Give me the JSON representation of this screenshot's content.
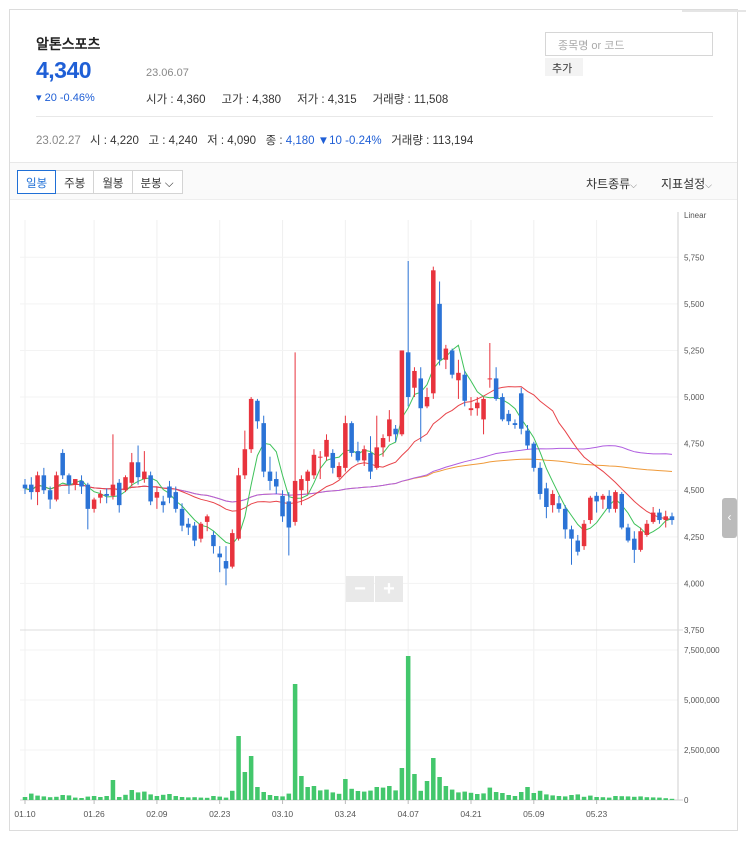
{
  "stock": {
    "name": "알톤스포츠",
    "price": "4,340",
    "date": "23.06.07",
    "change": "▾ 20 -0.46%",
    "stats": [
      "시가 : 4,360",
      "고가 : 4,380",
      "저가 : 4,315",
      "거래량 : 11,508"
    ]
  },
  "search": {
    "placeholder": "종목명 or 코드",
    "add_label": "추가"
  },
  "history": {
    "date": "23.02.27",
    "open": "시 : 4,220",
    "high": "고 : 4,240",
    "low": "저 : 4,090",
    "close_label": "종 :",
    "close_value": "4,180",
    "change": "▼10 -0.24%",
    "volume": "거래량 : 113,194"
  },
  "toolbar": {
    "tabs": [
      "일봉",
      "주봉",
      "월봉",
      "분봉"
    ],
    "chart_type": "차트종류",
    "indicator": "지표설정"
  },
  "colors": {
    "up": "#e8333d",
    "down": "#2b73d6",
    "ma5": "#3ec25a",
    "ma20": "#e8444a",
    "ma60": "#b05ee0",
    "ma120": "#ef9a3a",
    "volume": "#43c76c"
  },
  "chart_data": {
    "type": "candlestick",
    "price_axis": {
      "scale_label": "Linear",
      "ticks": [
        "5,750",
        "5,500",
        "5,250",
        "5,000",
        "4,750",
        "4,500",
        "4,250",
        "4,000",
        "3,750"
      ],
      "range": [
        3750,
        5950
      ]
    },
    "volume_axis": {
      "ticks": [
        "7,500,000",
        "5,000,000",
        "2,500,000",
        "0"
      ],
      "range": [
        0,
        8400000
      ]
    },
    "x_ticks": [
      {
        "label": "01.10",
        "index": 0
      },
      {
        "label": "01.26",
        "index": 11
      },
      {
        "label": "02.09",
        "index": 21
      },
      {
        "label": "02.23",
        "index": 31
      },
      {
        "label": "03.10",
        "index": 41
      },
      {
        "label": "03.24",
        "index": 51
      },
      {
        "label": "04.07",
        "index": 61
      },
      {
        "label": "04.21",
        "index": 71
      },
      {
        "label": "05.09",
        "index": 81
      },
      {
        "label": "05.23",
        "index": 91
      }
    ],
    "candles": [
      {
        "o": 4530,
        "h": 4560,
        "l": 4480,
        "c": 4510
      },
      {
        "o": 4530,
        "h": 4570,
        "l": 4450,
        "c": 4490
      },
      {
        "o": 4490,
        "h": 4600,
        "l": 4420,
        "c": 4580
      },
      {
        "o": 4580,
        "h": 4620,
        "l": 4480,
        "c": 4500
      },
      {
        "o": 4500,
        "h": 4520,
        "l": 4400,
        "c": 4450
      },
      {
        "o": 4450,
        "h": 4600,
        "l": 4440,
        "c": 4580
      },
      {
        "o": 4700,
        "h": 4720,
        "l": 4560,
        "c": 4580
      },
      {
        "o": 4580,
        "h": 4590,
        "l": 4480,
        "c": 4530
      },
      {
        "o": 4530,
        "h": 4560,
        "l": 4500,
        "c": 4560
      },
      {
        "o": 4550,
        "h": 4580,
        "l": 4480,
        "c": 4520
      },
      {
        "o": 4530,
        "h": 4540,
        "l": 4290,
        "c": 4400
      },
      {
        "o": 4400,
        "h": 4460,
        "l": 4380,
        "c": 4450
      },
      {
        "o": 4460,
        "h": 4500,
        "l": 4430,
        "c": 4480
      },
      {
        "o": 4480,
        "h": 4510,
        "l": 4430,
        "c": 4470
      },
      {
        "o": 4470,
        "h": 4800,
        "l": 4450,
        "c": 4530
      },
      {
        "o": 4540,
        "h": 4560,
        "l": 4380,
        "c": 4420
      },
      {
        "o": 4500,
        "h": 4580,
        "l": 4490,
        "c": 4570
      },
      {
        "o": 4540,
        "h": 4700,
        "l": 4520,
        "c": 4650
      },
      {
        "o": 4650,
        "h": 4740,
        "l": 4530,
        "c": 4570
      },
      {
        "o": 4560,
        "h": 4710,
        "l": 4540,
        "c": 4600
      },
      {
        "o": 4580,
        "h": 4600,
        "l": 4420,
        "c": 4440
      },
      {
        "o": 4460,
        "h": 4520,
        "l": 4400,
        "c": 4490
      },
      {
        "o": 4440,
        "h": 4470,
        "l": 4380,
        "c": 4420
      },
      {
        "o": 4520,
        "h": 4550,
        "l": 4430,
        "c": 4460
      },
      {
        "o": 4490,
        "h": 4520,
        "l": 4380,
        "c": 4400
      },
      {
        "o": 4400,
        "h": 4430,
        "l": 4280,
        "c": 4310
      },
      {
        "o": 4320,
        "h": 4350,
        "l": 4260,
        "c": 4300
      },
      {
        "o": 4310,
        "h": 4330,
        "l": 4200,
        "c": 4230
      },
      {
        "o": 4240,
        "h": 4330,
        "l": 4220,
        "c": 4320
      },
      {
        "o": 4330,
        "h": 4370,
        "l": 4280,
        "c": 4360
      },
      {
        "o": 4260,
        "h": 4280,
        "l": 4160,
        "c": 4200
      },
      {
        "o": 4160,
        "h": 4200,
        "l": 4060,
        "c": 4140
      },
      {
        "o": 4120,
        "h": 4200,
        "l": 3990,
        "c": 4080
      },
      {
        "o": 4090,
        "h": 4290,
        "l": 4080,
        "c": 4270
      },
      {
        "o": 4240,
        "h": 4620,
        "l": 4230,
        "c": 4580
      },
      {
        "o": 4580,
        "h": 4820,
        "l": 4560,
        "c": 4720
      },
      {
        "o": 4720,
        "h": 5000,
        "l": 4700,
        "c": 4990
      },
      {
        "o": 4980,
        "h": 4990,
        "l": 4830,
        "c": 4870
      },
      {
        "o": 4860,
        "h": 4900,
        "l": 4570,
        "c": 4600
      },
      {
        "o": 4600,
        "h": 4680,
        "l": 4500,
        "c": 4550
      },
      {
        "o": 4560,
        "h": 4600,
        "l": 4480,
        "c": 4520
      },
      {
        "o": 4470,
        "h": 4500,
        "l": 4330,
        "c": 4360
      },
      {
        "o": 4440,
        "h": 4490,
        "l": 4150,
        "c": 4300
      },
      {
        "o": 4330,
        "h": 5240,
        "l": 4310,
        "c": 4550
      },
      {
        "o": 4500,
        "h": 4580,
        "l": 4420,
        "c": 4560
      },
      {
        "o": 4550,
        "h": 4610,
        "l": 4480,
        "c": 4600
      },
      {
        "o": 4580,
        "h": 4720,
        "l": 4560,
        "c": 4690
      },
      {
        "o": 4680,
        "h": 4710,
        "l": 4560,
        "c": 4680
      },
      {
        "o": 4680,
        "h": 4800,
        "l": 4660,
        "c": 4770
      },
      {
        "o": 4700,
        "h": 4720,
        "l": 4590,
        "c": 4620
      },
      {
        "o": 4570,
        "h": 4650,
        "l": 4560,
        "c": 4630
      },
      {
        "o": 4620,
        "h": 4900,
        "l": 4600,
        "c": 4860
      },
      {
        "o": 4860,
        "h": 4870,
        "l": 4680,
        "c": 4700
      },
      {
        "o": 4710,
        "h": 4760,
        "l": 4650,
        "c": 4660
      },
      {
        "o": 4660,
        "h": 4740,
        "l": 4630,
        "c": 4720
      },
      {
        "o": 4700,
        "h": 4790,
        "l": 4560,
        "c": 4600
      },
      {
        "o": 4620,
        "h": 4900,
        "l": 4610,
        "c": 4730
      },
      {
        "o": 4730,
        "h": 4800,
        "l": 4680,
        "c": 4780
      },
      {
        "o": 4790,
        "h": 4930,
        "l": 4760,
        "c": 4880
      },
      {
        "o": 4830,
        "h": 4850,
        "l": 4760,
        "c": 4800
      },
      {
        "o": 4800,
        "h": 5250,
        "l": 4790,
        "c": 5250
      },
      {
        "o": 5240,
        "h": 5730,
        "l": 4950,
        "c": 5000
      },
      {
        "o": 5050,
        "h": 5160,
        "l": 5000,
        "c": 5140
      },
      {
        "o": 5100,
        "h": 5160,
        "l": 4760,
        "c": 4940
      },
      {
        "o": 4950,
        "h": 5050,
        "l": 4940,
        "c": 5000
      },
      {
        "o": 5020,
        "h": 5700,
        "l": 4990,
        "c": 5680
      },
      {
        "o": 5500,
        "h": 5620,
        "l": 5170,
        "c": 5200
      },
      {
        "o": 5200,
        "h": 5280,
        "l": 5150,
        "c": 5260
      },
      {
        "o": 5250,
        "h": 5260,
        "l": 5100,
        "c": 5120
      },
      {
        "o": 5090,
        "h": 5200,
        "l": 4990,
        "c": 5130
      },
      {
        "o": 5120,
        "h": 5140,
        "l": 4950,
        "c": 4980
      },
      {
        "o": 4930,
        "h": 5000,
        "l": 4900,
        "c": 4940
      },
      {
        "o": 4940,
        "h": 5000,
        "l": 4900,
        "c": 4970
      },
      {
        "o": 4880,
        "h": 5000,
        "l": 4800,
        "c": 4990
      },
      {
        "o": 5100,
        "h": 5290,
        "l": 5050,
        "c": 5100
      },
      {
        "o": 5100,
        "h": 5160,
        "l": 4980,
        "c": 4990
      },
      {
        "o": 5000,
        "h": 5020,
        "l": 4870,
        "c": 4880
      },
      {
        "o": 4910,
        "h": 4930,
        "l": 4850,
        "c": 4870
      },
      {
        "o": 4860,
        "h": 4880,
        "l": 4830,
        "c": 4850
      },
      {
        "o": 5020,
        "h": 5050,
        "l": 4800,
        "c": 4830
      },
      {
        "o": 4820,
        "h": 4850,
        "l": 4720,
        "c": 4740
      },
      {
        "o": 4750,
        "h": 4760,
        "l": 4600,
        "c": 4620
      },
      {
        "o": 4620,
        "h": 4650,
        "l": 4450,
        "c": 4480
      },
      {
        "o": 4510,
        "h": 4540,
        "l": 4350,
        "c": 4410
      },
      {
        "o": 4420,
        "h": 4500,
        "l": 4380,
        "c": 4480
      },
      {
        "o": 4430,
        "h": 4470,
        "l": 4380,
        "c": 4400
      },
      {
        "o": 4400,
        "h": 4420,
        "l": 4240,
        "c": 4290
      },
      {
        "o": 4290,
        "h": 4310,
        "l": 4100,
        "c": 4240
      },
      {
        "o": 4230,
        "h": 4260,
        "l": 4150,
        "c": 4170
      },
      {
        "o": 4200,
        "h": 4340,
        "l": 4180,
        "c": 4320
      },
      {
        "o": 4340,
        "h": 4470,
        "l": 4320,
        "c": 4460
      },
      {
        "o": 4470,
        "h": 4490,
        "l": 4380,
        "c": 4440
      },
      {
        "o": 4450,
        "h": 4480,
        "l": 4400,
        "c": 4470
      },
      {
        "o": 4470,
        "h": 4500,
        "l": 4380,
        "c": 4400
      },
      {
        "o": 4400,
        "h": 4500,
        "l": 4380,
        "c": 4490
      },
      {
        "o": 4480,
        "h": 4490,
        "l": 4290,
        "c": 4300
      },
      {
        "o": 4300,
        "h": 4320,
        "l": 4220,
        "c": 4230
      },
      {
        "o": 4240,
        "h": 4280,
        "l": 4110,
        "c": 4180
      },
      {
        "o": 4180,
        "h": 4300,
        "l": 4170,
        "c": 4280
      },
      {
        "o": 4260,
        "h": 4340,
        "l": 4250,
        "c": 4320
      },
      {
        "o": 4330,
        "h": 4410,
        "l": 4320,
        "c": 4380
      },
      {
        "o": 4380,
        "h": 4400,
        "l": 4320,
        "c": 4340
      },
      {
        "o": 4340,
        "h": 4390,
        "l": 4300,
        "c": 4360
      },
      {
        "o": 4360,
        "h": 4380,
        "l": 4315,
        "c": 4340
      }
    ],
    "volume": [
      150000,
      320000,
      220000,
      180000,
      140000,
      160000,
      250000,
      230000,
      120000,
      100000,
      170000,
      200000,
      150000,
      200000,
      1000000,
      150000,
      260000,
      500000,
      380000,
      420000,
      280000,
      200000,
      260000,
      300000,
      200000,
      150000,
      130000,
      140000,
      120000,
      110000,
      200000,
      170000,
      120000,
      460000,
      3200000,
      1400000,
      2200000,
      650000,
      400000,
      250000,
      200000,
      180000,
      320000,
      5800000,
      1200000,
      650000,
      700000,
      480000,
      520000,
      380000,
      310000,
      1050000,
      560000,
      450000,
      420000,
      470000,
      650000,
      620000,
      700000,
      480000,
      1600000,
      7200000,
      1300000,
      460000,
      950000,
      2100000,
      1150000,
      700000,
      520000,
      380000,
      420000,
      360000,
      300000,
      330000,
      620000,
      400000,
      350000,
      250000,
      200000,
      400000,
      650000,
      350000,
      460000,
      280000,
      230000,
      200000,
      180000,
      250000,
      280000,
      160000,
      220000,
      150000,
      140000,
      120000,
      200000,
      190000,
      180000,
      160000,
      180000,
      140000,
      130000,
      120000,
      90000,
      60000
    ]
  }
}
